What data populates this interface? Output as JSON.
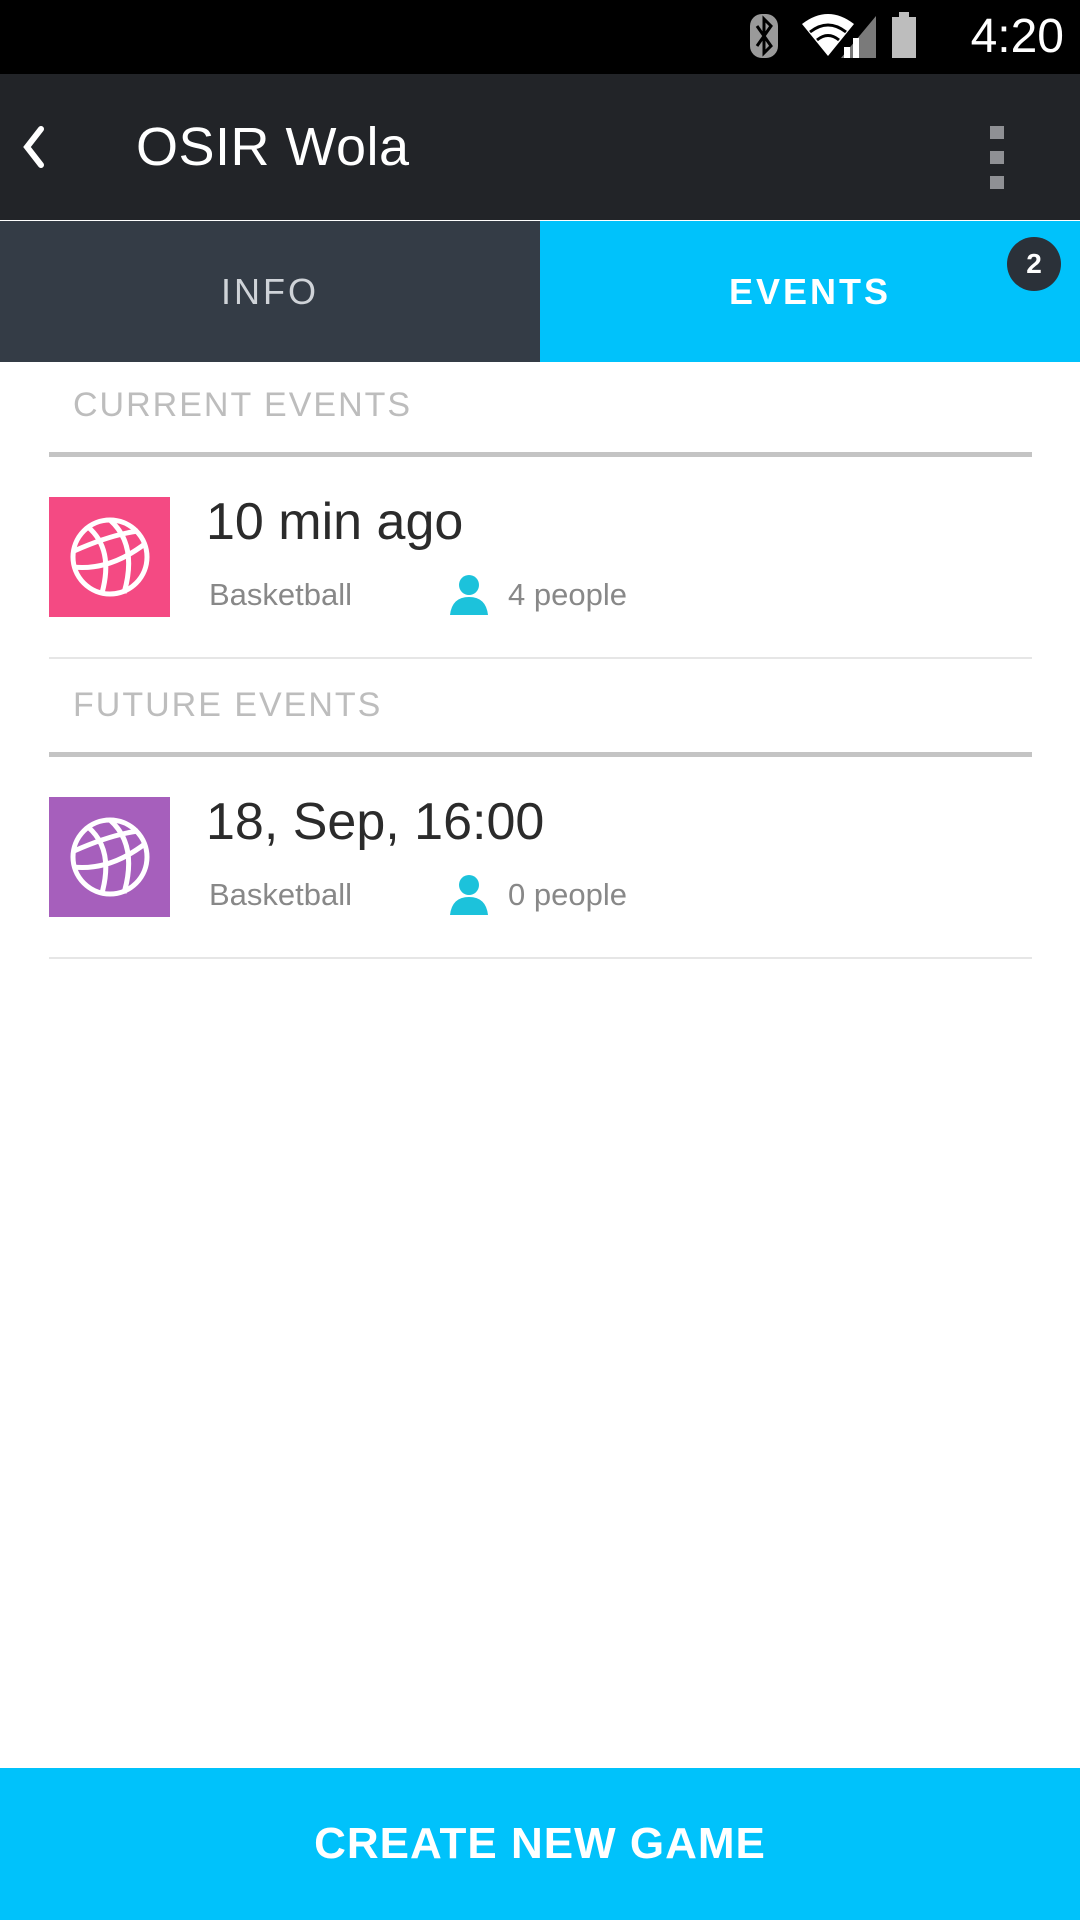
{
  "status_bar": {
    "time": "4:20",
    "icons": [
      "bluetooth-icon",
      "wifi-icon",
      "signal-icon",
      "battery-icon"
    ]
  },
  "app_bar": {
    "title": "OSIR Wola",
    "back_icon": "chevron-left-icon",
    "menu_icon": "overflow-menu-icon"
  },
  "tabs": [
    {
      "label": "INFO",
      "selected": false
    },
    {
      "label": "EVENTS",
      "selected": true,
      "badge": "2"
    }
  ],
  "sections": [
    {
      "header": "CURRENT EVENTS",
      "events": [
        {
          "title": "10 min ago",
          "sport": "Basketball",
          "people": "4 people",
          "icon": "basketball-icon",
          "color": "#f44a83"
        }
      ]
    },
    {
      "header": "FUTURE EVENTS",
      "events": [
        {
          "title": "18, Sep, 16:00",
          "sport": "Basketball",
          "people": "0 people",
          "icon": "basketball-icon",
          "color": "#a65fbc"
        }
      ]
    }
  ],
  "colors": {
    "accent": "#00c2fb",
    "app_bar": "#222428",
    "tab_inactive": "#343c46",
    "person_icon": "#1cc2db"
  },
  "create_button": {
    "label": "CREATE NEW GAME"
  }
}
